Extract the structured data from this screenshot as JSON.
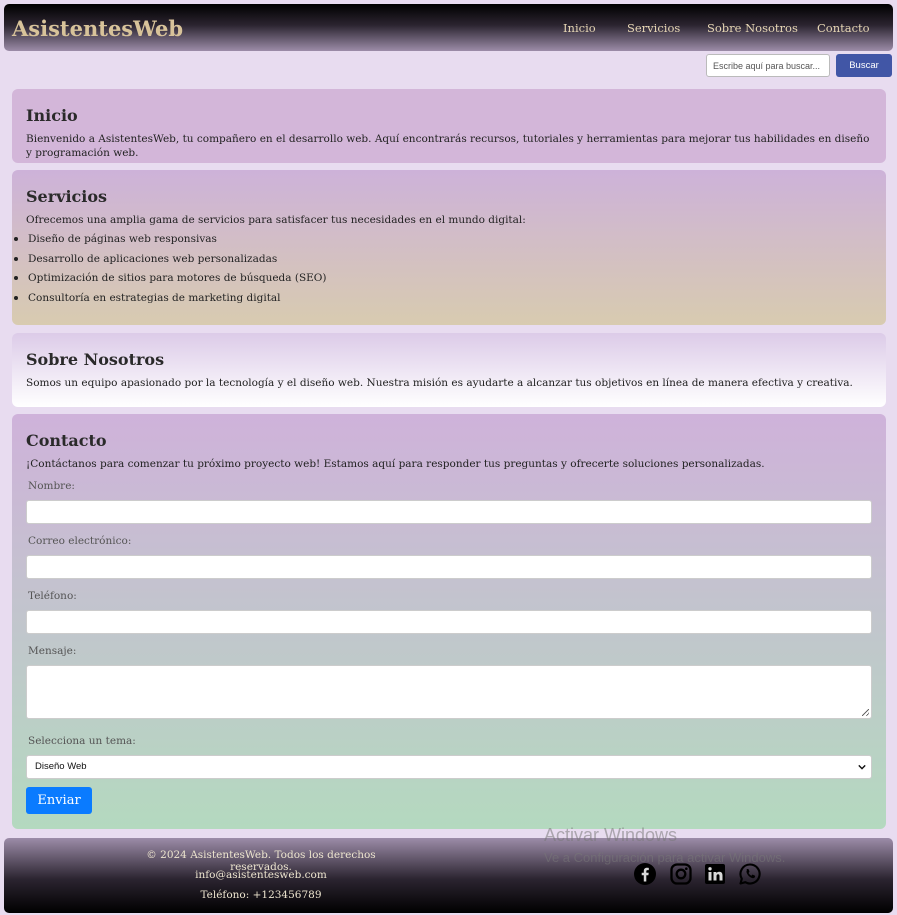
{
  "header": {
    "logo": "AsistentesWeb",
    "nav": [
      "Inicio",
      "Servicios",
      "Sobre Nosotros",
      "Contacto"
    ]
  },
  "search": {
    "placeholder": "Escribe aquí para buscar...",
    "button_label": "Buscar"
  },
  "sections": {
    "inicio": {
      "title": "Inicio",
      "text": "Bienvenido a AsistentesWeb, tu compañero en el desarrollo web. Aquí encontrarás recursos, tutoriales y herramientas para mejorar tus habilidades en diseño y programación web."
    },
    "servicios": {
      "title": "Servicios",
      "text": "Ofrecemos una amplia gama de servicios para satisfacer tus necesidades en el mundo digital:",
      "items": [
        "Diseño de páginas web responsivas",
        "Desarrollo de aplicaciones web personalizadas",
        "Optimización de sitios para motores de búsqueda (SEO)",
        "Consultoría en estrategias de marketing digital"
      ]
    },
    "sobre": {
      "title": "Sobre Nosotros",
      "text": "Somos un equipo apasionado por la tecnología y el diseño web. Nuestra misión es ayudarte a alcanzar tus objetivos en línea de manera efectiva y creativa."
    },
    "contacto": {
      "title": "Contacto",
      "text": "¡Contáctanos para comenzar tu próximo proyecto web! Estamos aquí para responder tus preguntas y ofrecerte soluciones personalizadas.",
      "labels": {
        "name": "Nombre:",
        "email": "Correo electrónico:",
        "phone": "Teléfono:",
        "message": "Mensaje:",
        "topic": "Selecciona un tema:"
      },
      "topic_selected": "Diseño Web",
      "send_label": "Enviar"
    }
  },
  "footer": {
    "copyright": "© 2024 AsistentesWeb. Todos los derechos reservados.",
    "email": "info@asistentesweb.com",
    "phone": "Teléfono: +123456789",
    "social_icons": [
      "facebook-icon",
      "instagram-icon",
      "linkedin-icon",
      "whatsapp-icon"
    ]
  },
  "watermark": {
    "title": "Activar Windows",
    "subtitle": "Ve a Configuración para activar Windows."
  }
}
